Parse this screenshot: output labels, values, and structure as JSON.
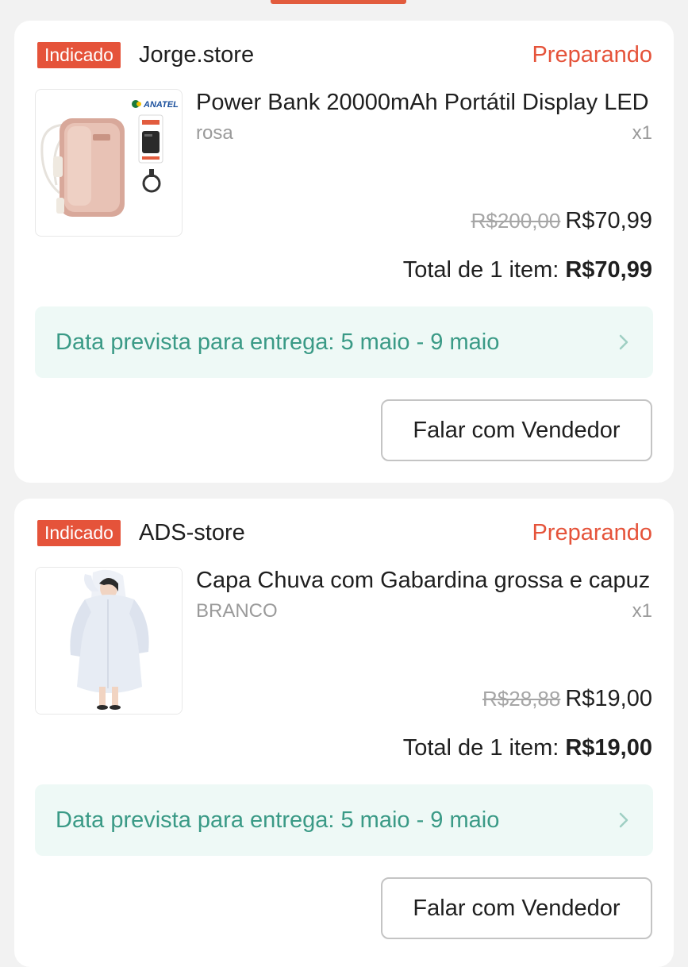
{
  "orders": [
    {
      "badge": "Indicado",
      "store": "Jorge.store",
      "status": "Preparando",
      "product_title": "Power Bank 20000mAh Portátil Display LED",
      "thumb_logo_text": "ANATEL",
      "variant": "rosa",
      "qty": "x1",
      "old_price": "R$200,00",
      "price": "R$70,99",
      "total_label": "Total de 1 item:",
      "total_value": "R$70,99",
      "delivery": "Data prevista para entrega: 5 maio - 9 maio",
      "chat_button": "Falar com Vendedor"
    },
    {
      "badge": "Indicado",
      "store": "ADS-store",
      "status": "Preparando",
      "product_title": "Capa Chuva com Gabardina grossa e capuz",
      "variant": "BRANCO",
      "qty": "x1",
      "old_price": "R$28,88",
      "price": "R$19,00",
      "total_label": "Total de 1 item:",
      "total_value": "R$19,00",
      "delivery": "Data prevista para entrega: 5 maio - 9 maio",
      "chat_button": "Falar com Vendedor"
    }
  ],
  "colors": {
    "accent": "#e5533a",
    "delivery_text": "#3a9a86",
    "delivery_bg": "#eef9f6",
    "page_bg": "#f2f2f2"
  },
  "icons": {
    "chevron": "chevron-right-icon"
  }
}
